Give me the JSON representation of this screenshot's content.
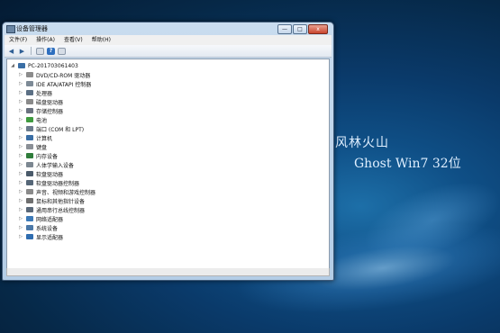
{
  "desktop": {
    "title": "风林火山",
    "subtitle": "Ghost Win7 32位"
  },
  "window": {
    "title": "设备管理器",
    "controls": {
      "minimize": "—",
      "maximize": "□",
      "close": "x"
    },
    "menu": [
      "文件(F)",
      "操作(A)",
      "查看(V)",
      "帮助(H)"
    ],
    "toolbar": {
      "back": "◀",
      "forward": "▶",
      "help": "?"
    },
    "tree": {
      "root": "PC-201703061403",
      "items": [
        {
          "label": "DVD/CD-ROM 驱动器",
          "icon": "dvd-drive-icon",
          "color": "#8c8c8c"
        },
        {
          "label": "IDE ATA/ATAPI 控制器",
          "icon": "ide-controller-icon",
          "color": "#7d8a96"
        },
        {
          "label": "处理器",
          "icon": "processor-icon",
          "color": "#5b6f84"
        },
        {
          "label": "磁盘驱动器",
          "icon": "disk-drive-icon",
          "color": "#8a8a8a"
        },
        {
          "label": "存储控制器",
          "icon": "storage-controller-icon",
          "color": "#6b7280"
        },
        {
          "label": "电池",
          "icon": "battery-icon",
          "color": "#3f9b3f"
        },
        {
          "label": "端口 (COM 和 LPT)",
          "icon": "port-icon",
          "color": "#6b7b8c"
        },
        {
          "label": "计算机",
          "icon": "computer-icon",
          "color": "#3a6ea5"
        },
        {
          "label": "键盘",
          "icon": "keyboard-icon",
          "color": "#8a8f96"
        },
        {
          "label": "内存设备",
          "icon": "memory-icon",
          "color": "#2f7d3b"
        },
        {
          "label": "人体学输入设备",
          "icon": "hid-icon",
          "color": "#7c8791"
        },
        {
          "label": "软盘驱动器",
          "icon": "floppy-drive-icon",
          "color": "#4a5a6a"
        },
        {
          "label": "软盘驱动器控制器",
          "icon": "floppy-controller-icon",
          "color": "#556677"
        },
        {
          "label": "声音、视频和游戏控制器",
          "icon": "sound-icon",
          "color": "#8a8a8a"
        },
        {
          "label": "鼠标和其他指针设备",
          "icon": "mouse-icon",
          "color": "#6f6f6f"
        },
        {
          "label": "通用串行总线控制器",
          "icon": "usb-icon",
          "color": "#5a6878"
        },
        {
          "label": "网络适配器",
          "icon": "network-adapter-icon",
          "color": "#3c7ab8"
        },
        {
          "label": "系统设备",
          "icon": "system-device-icon",
          "color": "#4c79a8"
        },
        {
          "label": "显示适配器",
          "icon": "display-adapter-icon",
          "color": "#2f6db0"
        }
      ]
    }
  }
}
